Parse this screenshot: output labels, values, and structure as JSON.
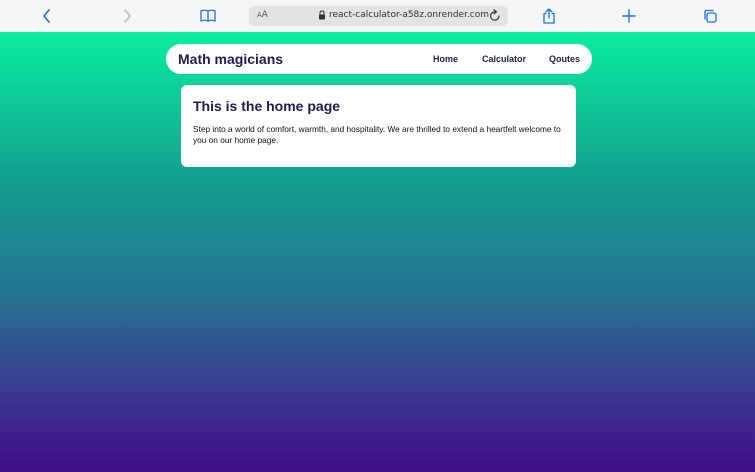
{
  "browser": {
    "address_aa_small": "A",
    "address_aa_large": "A",
    "url": "react-calculator-a58z.onrender.com",
    "accent": "#1a73e8"
  },
  "navbar": {
    "brand": "Math magicians",
    "links": [
      {
        "label": "Home"
      },
      {
        "label": "Calculator"
      },
      {
        "label": "Qoutes"
      }
    ]
  },
  "main": {
    "heading": "This is the home page",
    "body": "Step into a world of comfort, warmth, and hospitality. We are thrilled to extend a heartfelt welcome to you on our home page."
  },
  "colors": {
    "gradient_top": "#0aee9e",
    "gradient_bottom": "#3f0c87",
    "text_dark": "#1c1d52"
  }
}
